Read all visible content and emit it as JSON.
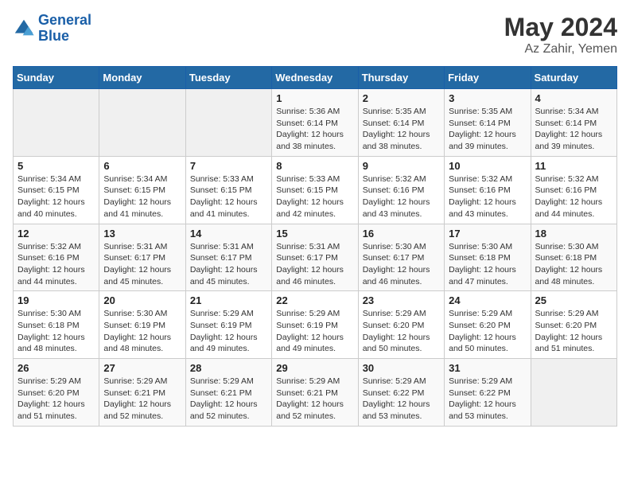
{
  "logo": {
    "line1": "General",
    "line2": "Blue"
  },
  "title": "May 2024",
  "subtitle": "Az Zahir, Yemen",
  "days_of_week": [
    "Sunday",
    "Monday",
    "Tuesday",
    "Wednesday",
    "Thursday",
    "Friday",
    "Saturday"
  ],
  "weeks": [
    [
      {
        "num": "",
        "info": ""
      },
      {
        "num": "",
        "info": ""
      },
      {
        "num": "",
        "info": ""
      },
      {
        "num": "1",
        "info": "Sunrise: 5:36 AM\nSunset: 6:14 PM\nDaylight: 12 hours and 38 minutes."
      },
      {
        "num": "2",
        "info": "Sunrise: 5:35 AM\nSunset: 6:14 PM\nDaylight: 12 hours and 38 minutes."
      },
      {
        "num": "3",
        "info": "Sunrise: 5:35 AM\nSunset: 6:14 PM\nDaylight: 12 hours and 39 minutes."
      },
      {
        "num": "4",
        "info": "Sunrise: 5:34 AM\nSunset: 6:14 PM\nDaylight: 12 hours and 39 minutes."
      }
    ],
    [
      {
        "num": "5",
        "info": "Sunrise: 5:34 AM\nSunset: 6:15 PM\nDaylight: 12 hours and 40 minutes."
      },
      {
        "num": "6",
        "info": "Sunrise: 5:34 AM\nSunset: 6:15 PM\nDaylight: 12 hours and 41 minutes."
      },
      {
        "num": "7",
        "info": "Sunrise: 5:33 AM\nSunset: 6:15 PM\nDaylight: 12 hours and 41 minutes."
      },
      {
        "num": "8",
        "info": "Sunrise: 5:33 AM\nSunset: 6:15 PM\nDaylight: 12 hours and 42 minutes."
      },
      {
        "num": "9",
        "info": "Sunrise: 5:32 AM\nSunset: 6:16 PM\nDaylight: 12 hours and 43 minutes."
      },
      {
        "num": "10",
        "info": "Sunrise: 5:32 AM\nSunset: 6:16 PM\nDaylight: 12 hours and 43 minutes."
      },
      {
        "num": "11",
        "info": "Sunrise: 5:32 AM\nSunset: 6:16 PM\nDaylight: 12 hours and 44 minutes."
      }
    ],
    [
      {
        "num": "12",
        "info": "Sunrise: 5:32 AM\nSunset: 6:16 PM\nDaylight: 12 hours and 44 minutes."
      },
      {
        "num": "13",
        "info": "Sunrise: 5:31 AM\nSunset: 6:17 PM\nDaylight: 12 hours and 45 minutes."
      },
      {
        "num": "14",
        "info": "Sunrise: 5:31 AM\nSunset: 6:17 PM\nDaylight: 12 hours and 45 minutes."
      },
      {
        "num": "15",
        "info": "Sunrise: 5:31 AM\nSunset: 6:17 PM\nDaylight: 12 hours and 46 minutes."
      },
      {
        "num": "16",
        "info": "Sunrise: 5:30 AM\nSunset: 6:17 PM\nDaylight: 12 hours and 46 minutes."
      },
      {
        "num": "17",
        "info": "Sunrise: 5:30 AM\nSunset: 6:18 PM\nDaylight: 12 hours and 47 minutes."
      },
      {
        "num": "18",
        "info": "Sunrise: 5:30 AM\nSunset: 6:18 PM\nDaylight: 12 hours and 48 minutes."
      }
    ],
    [
      {
        "num": "19",
        "info": "Sunrise: 5:30 AM\nSunset: 6:18 PM\nDaylight: 12 hours and 48 minutes."
      },
      {
        "num": "20",
        "info": "Sunrise: 5:30 AM\nSunset: 6:19 PM\nDaylight: 12 hours and 48 minutes."
      },
      {
        "num": "21",
        "info": "Sunrise: 5:29 AM\nSunset: 6:19 PM\nDaylight: 12 hours and 49 minutes."
      },
      {
        "num": "22",
        "info": "Sunrise: 5:29 AM\nSunset: 6:19 PM\nDaylight: 12 hours and 49 minutes."
      },
      {
        "num": "23",
        "info": "Sunrise: 5:29 AM\nSunset: 6:20 PM\nDaylight: 12 hours and 50 minutes."
      },
      {
        "num": "24",
        "info": "Sunrise: 5:29 AM\nSunset: 6:20 PM\nDaylight: 12 hours and 50 minutes."
      },
      {
        "num": "25",
        "info": "Sunrise: 5:29 AM\nSunset: 6:20 PM\nDaylight: 12 hours and 51 minutes."
      }
    ],
    [
      {
        "num": "26",
        "info": "Sunrise: 5:29 AM\nSunset: 6:20 PM\nDaylight: 12 hours and 51 minutes."
      },
      {
        "num": "27",
        "info": "Sunrise: 5:29 AM\nSunset: 6:21 PM\nDaylight: 12 hours and 52 minutes."
      },
      {
        "num": "28",
        "info": "Sunrise: 5:29 AM\nSunset: 6:21 PM\nDaylight: 12 hours and 52 minutes."
      },
      {
        "num": "29",
        "info": "Sunrise: 5:29 AM\nSunset: 6:21 PM\nDaylight: 12 hours and 52 minutes."
      },
      {
        "num": "30",
        "info": "Sunrise: 5:29 AM\nSunset: 6:22 PM\nDaylight: 12 hours and 53 minutes."
      },
      {
        "num": "31",
        "info": "Sunrise: 5:29 AM\nSunset: 6:22 PM\nDaylight: 12 hours and 53 minutes."
      },
      {
        "num": "",
        "info": ""
      }
    ]
  ]
}
